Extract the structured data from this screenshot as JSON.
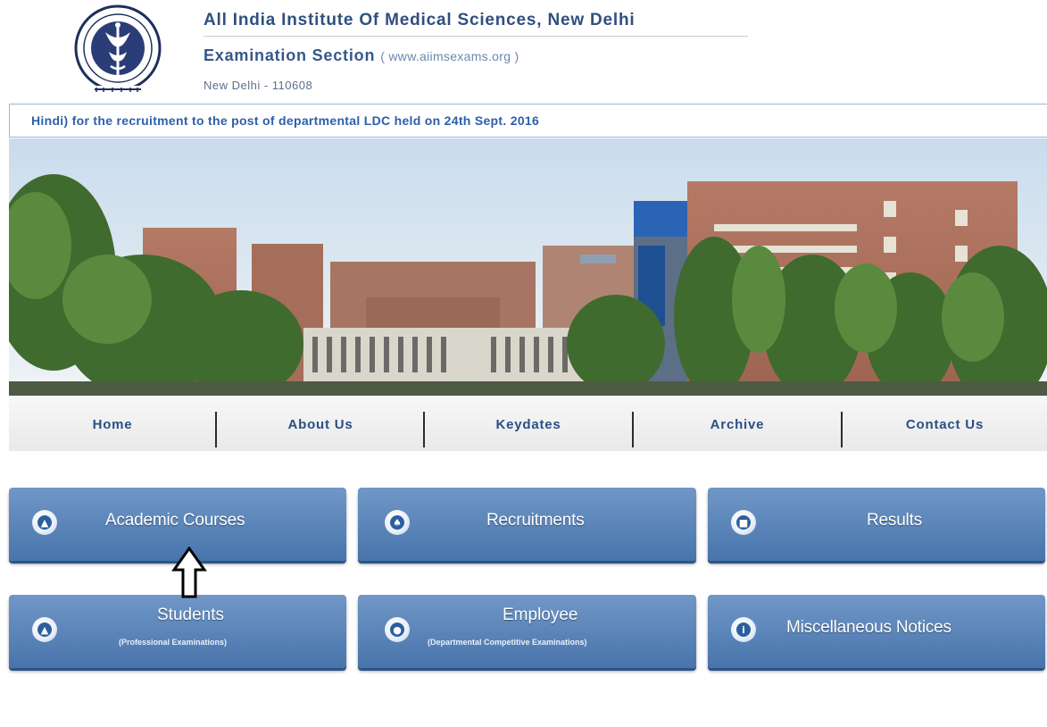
{
  "header": {
    "title": "All India Institute Of Medical Sciences, New Delhi",
    "section": "Examination Section",
    "website": "( www.aiimsexams.org )",
    "address": "New Delhi - 110608"
  },
  "marquee": {
    "text": "Hindi) for the recruitment to the post of departmental LDC held on 24th Sept. 2016"
  },
  "nav": {
    "items": [
      {
        "label": "Home"
      },
      {
        "label": "About Us"
      },
      {
        "label": "Keydates"
      },
      {
        "label": "Archive"
      },
      {
        "label": "Contact Us"
      }
    ]
  },
  "tiles": {
    "academic": {
      "label": "Academic Courses",
      "icon": "graduate-icon"
    },
    "recruitments": {
      "label": "Recruitments",
      "icon": "people-icon"
    },
    "results": {
      "label": "Results",
      "icon": "chart-icon"
    },
    "students": {
      "label": "Students",
      "sub": "(Professional Examinations)",
      "icon": "student-icon"
    },
    "employee": {
      "label": "Employee",
      "sub": "(Departmental Competitive Examinations)",
      "icon": "employee-icon"
    },
    "misc": {
      "label": "Miscellaneous Notices",
      "icon": "info-icon"
    }
  },
  "colors": {
    "accent": "#5a84b8",
    "title": "#2f4f7f",
    "marquee_text": "#2d5faa"
  }
}
